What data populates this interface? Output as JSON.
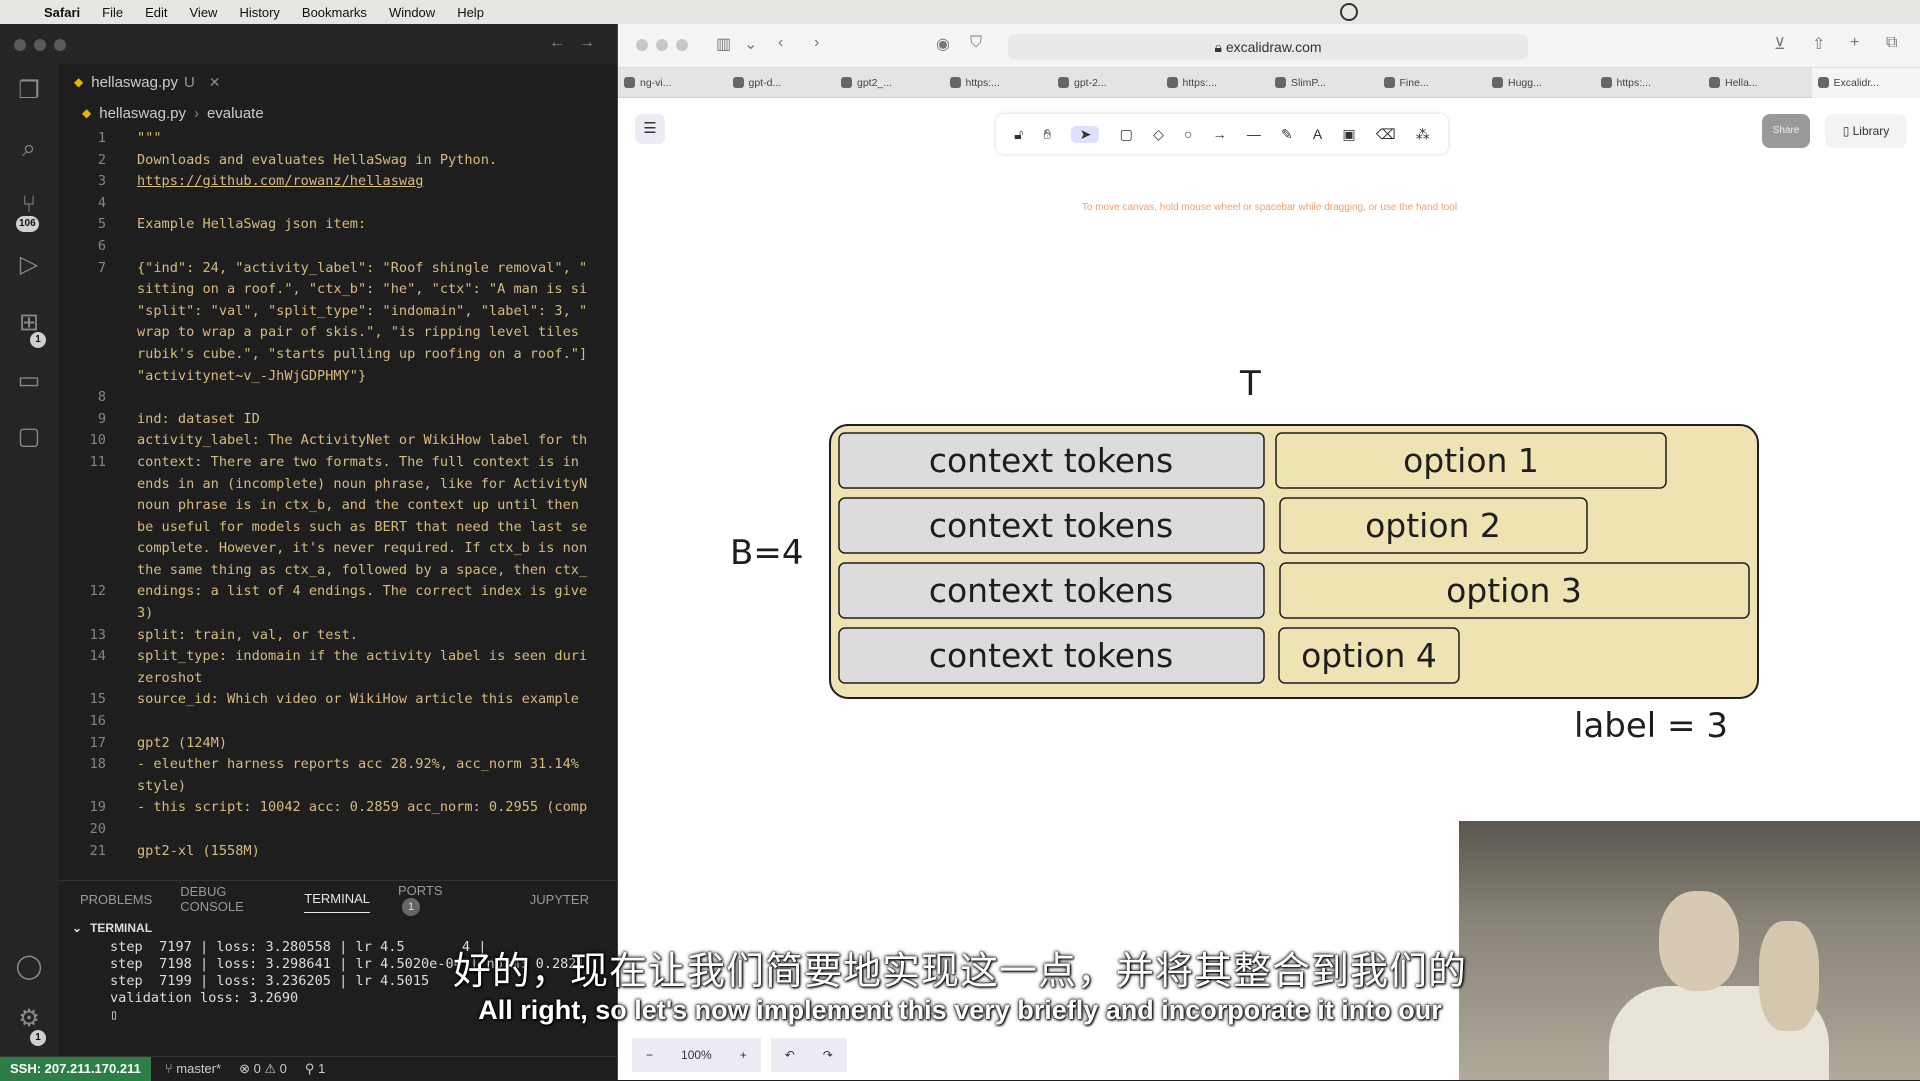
{
  "menubar": {
    "app": "Safari",
    "items": [
      "File",
      "Edit",
      "View",
      "History",
      "Bookmarks",
      "Window",
      "Help"
    ]
  },
  "vscode": {
    "tab": {
      "file": "hellaswag.py",
      "state": "U"
    },
    "breadcrumb": {
      "file": "hellaswag.py",
      "symbol": "evaluate"
    },
    "activity_badges": {
      "source_control": "106",
      "extensions": "1",
      "accounts": "1"
    },
    "code_lines": [
      {
        "n": "1",
        "t": "\"\"\""
      },
      {
        "n": "2",
        "t": "Downloads and evaluates HellaSwag in Python."
      },
      {
        "n": "3",
        "t": "https://github.com/rowanz/hellaswag"
      },
      {
        "n": "4",
        "t": ""
      },
      {
        "n": "5",
        "t": "Example HellaSwag json item:"
      },
      {
        "n": "6",
        "t": ""
      },
      {
        "n": "7",
        "t": "{\"ind\": 24, \"activity_label\": \"Roof shingle removal\", \""
      },
      {
        "n": "",
        "t": "sitting on a roof.\", \"ctx_b\": \"he\", \"ctx\": \"A man is si"
      },
      {
        "n": "",
        "t": "\"split\": \"val\", \"split_type\": \"indomain\", \"label\": 3, \""
      },
      {
        "n": "",
        "t": "wrap to wrap a pair of skis.\", \"is ripping level tiles"
      },
      {
        "n": "",
        "t": "rubik's cube.\", \"starts pulling up roofing on a roof.\"]"
      },
      {
        "n": "",
        "t": "\"activitynet~v_-JhWjGDPHMY\"}"
      },
      {
        "n": "8",
        "t": ""
      },
      {
        "n": "9",
        "t": "ind: dataset ID"
      },
      {
        "n": "10",
        "t": "activity_label: The ActivityNet or WikiHow label for th"
      },
      {
        "n": "11",
        "t": "context: There are two formats. The full context is in"
      },
      {
        "n": "",
        "t": "ends in an (incomplete) noun phrase, like for ActivityN"
      },
      {
        "n": "",
        "t": "noun phrase is in ctx_b, and the context up until then"
      },
      {
        "n": "",
        "t": "be useful for models such as BERT that need the last se"
      },
      {
        "n": "",
        "t": "complete. However, it's never required. If ctx_b is non"
      },
      {
        "n": "",
        "t": "the same thing as ctx_a, followed by a space, then ctx_"
      },
      {
        "n": "12",
        "t": "endings: a list of 4 endings. The correct index is give"
      },
      {
        "n": "",
        "t": "3)"
      },
      {
        "n": "13",
        "t": "split: train, val, or test."
      },
      {
        "n": "14",
        "t": "split_type: indomain if the activity label is seen duri"
      },
      {
        "n": "",
        "t": "zeroshot"
      },
      {
        "n": "15",
        "t": "source_id: Which video or WikiHow article this example"
      },
      {
        "n": "16",
        "t": ""
      },
      {
        "n": "17",
        "t": "gpt2 (124M)"
      },
      {
        "n": "18",
        "t": "- eleuther harness reports acc 28.92%, acc_norm 31.14%"
      },
      {
        "n": "",
        "t": "style)"
      },
      {
        "n": "19",
        "t": "- this script: 10042 acc: 0.2859 acc_norm: 0.2955 (comp"
      },
      {
        "n": "20",
        "t": ""
      },
      {
        "n": "21",
        "t": "gpt2-xl (1558M)"
      }
    ],
    "panel_tabs": [
      "PROBLEMS",
      "DEBUG CONSOLE",
      "TERMINAL",
      "PORTS",
      "JUPYTER"
    ],
    "ports_count": "1",
    "terminal_label": "TERMINAL",
    "terminal_lines": [
      "step  7197 | loss: 3.280558 | lr 4.5       4 |",
      "step  7198 | loss: 3.298641 | lr 4.5020e-04 | norm: 0.2821",
      "step  7199 | loss: 3.236205 | lr 4.5015",
      "validation loss: 3.2690"
    ],
    "status": {
      "ssh": "SSH: 207.211.170.211",
      "branch": "master*",
      "problems": "0 ⚠ 0",
      "ports": "1"
    }
  },
  "safari": {
    "url": "excalidraw.com",
    "tabs": [
      "ng-vi...",
      "gpt-d...",
      "gpt2_...",
      "https:...",
      "gpt-2...",
      "https:...",
      "SlimP...",
      "Fine...",
      "Hugg...",
      "https:...",
      "Hella...",
      "Excalidr..."
    ],
    "excalidraw": {
      "hint": "To move canvas, hold mouse wheel or spacebar while dragging, or use the hand tool",
      "share": "Share",
      "library": "Library",
      "zoom": "100%"
    }
  },
  "diagram": {
    "t_label": "T",
    "b_label": "B=4",
    "context_label": "context tokens",
    "options": [
      "option 1",
      "option 2",
      "option 3",
      "option 4"
    ],
    "label_text": "label = 3"
  },
  "subtitles": {
    "zh": "好的，现在让我们简要地实现这一点，并将其整合到我们的",
    "en": "All right, so let's now implement this very briefly and incorporate it into our"
  }
}
